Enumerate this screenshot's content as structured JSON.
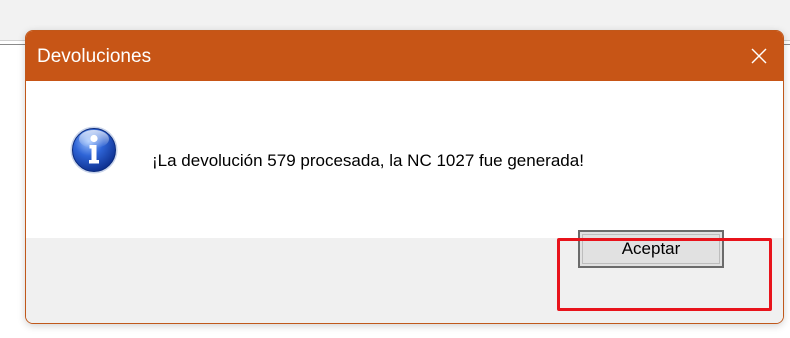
{
  "dialog": {
    "title": "Devoluciones",
    "close_icon": "close-icon",
    "message_icon": "info-icon",
    "message": "¡La devolución 579 procesada, la NC 1027 fue generada!",
    "ok_label": "Aceptar"
  },
  "colors": {
    "titlebar": "#c75516",
    "highlight": "#e8131b",
    "button_face": "#e1e1e1"
  }
}
